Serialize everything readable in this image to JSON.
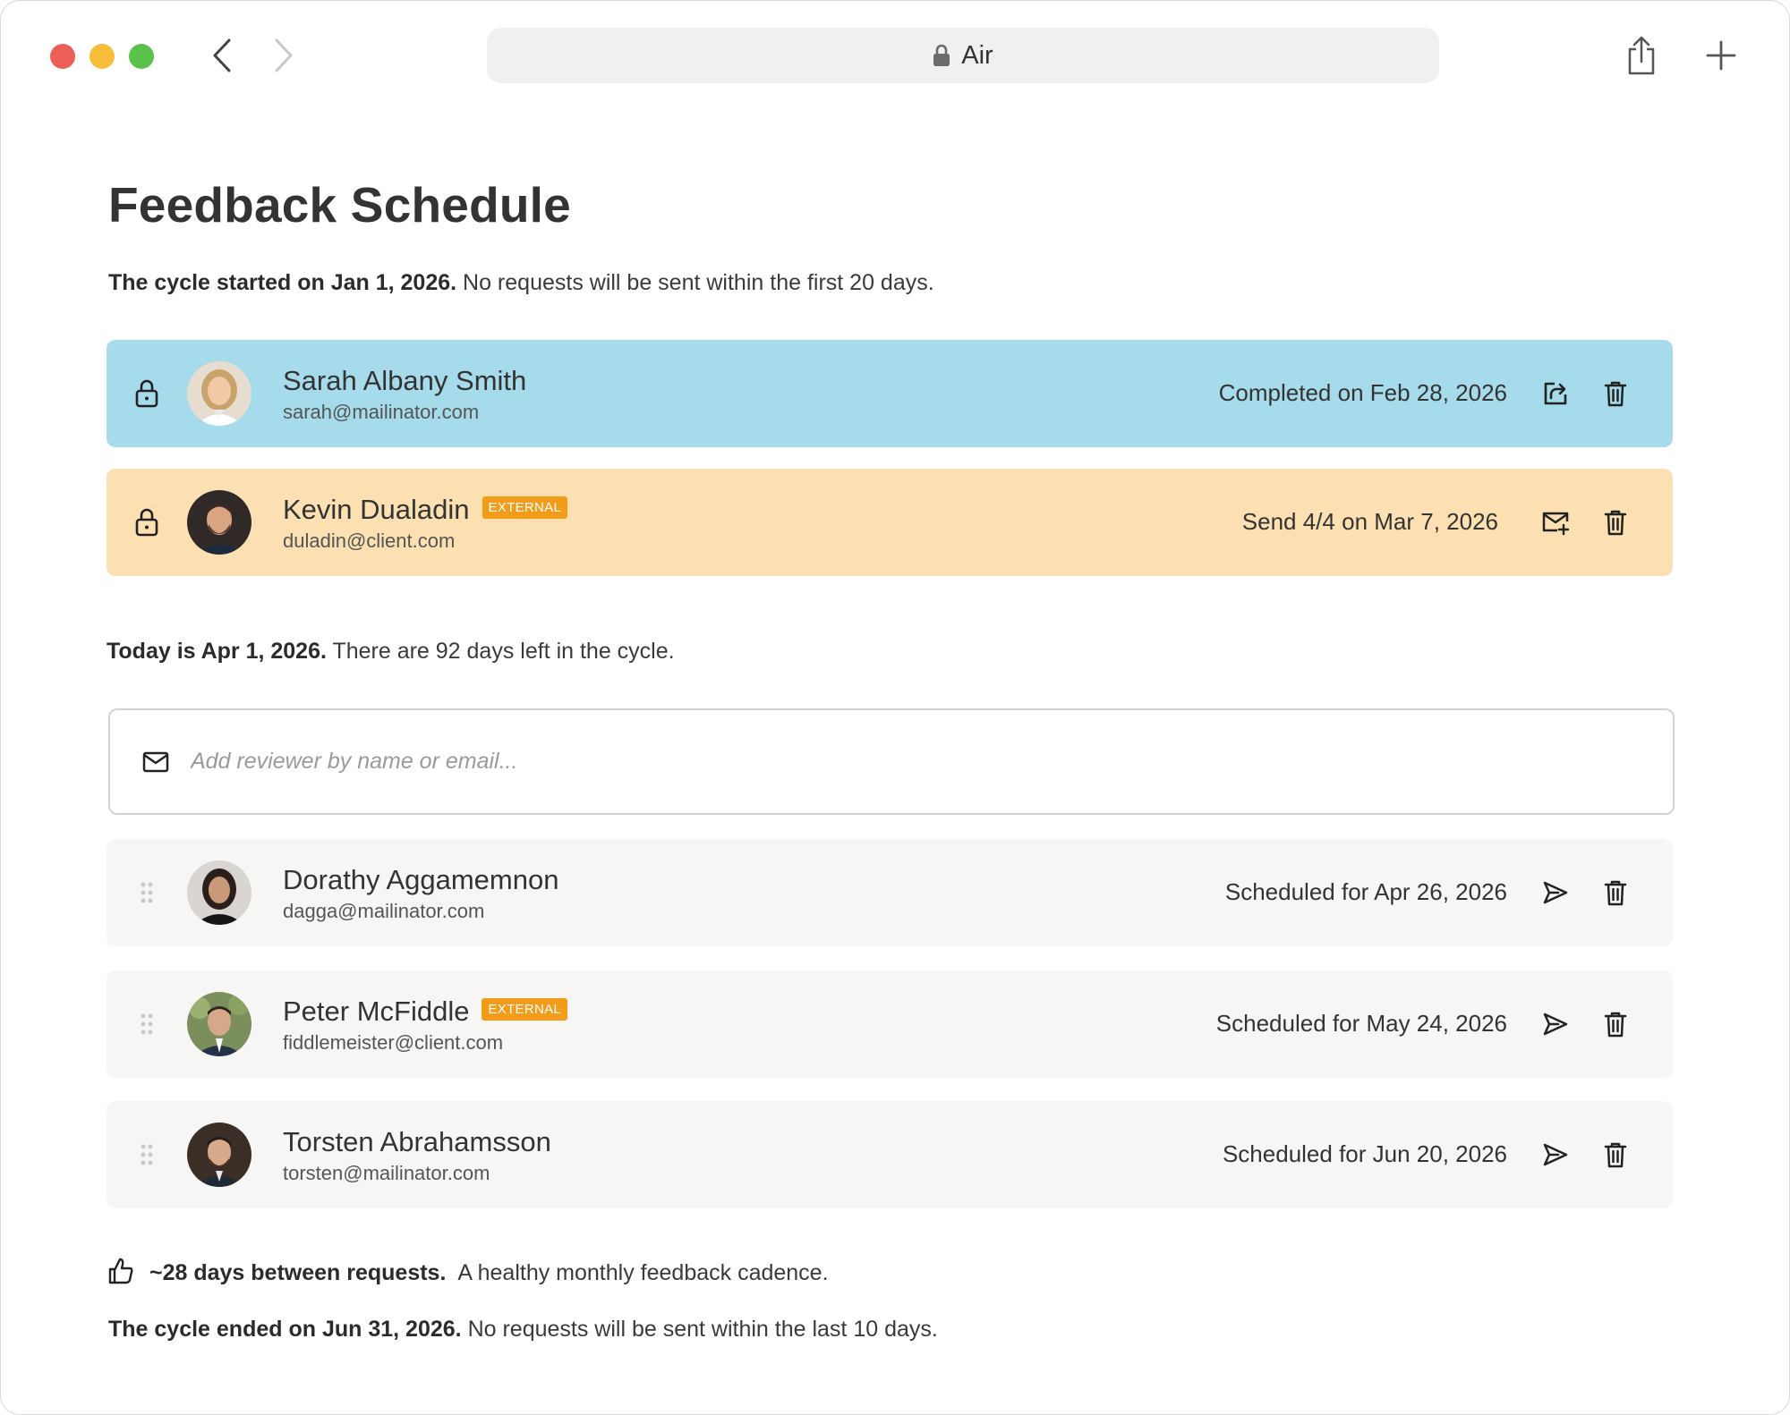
{
  "browser": {
    "url": "Air"
  },
  "page": {
    "title": "Feedback Schedule",
    "cycle_start": {
      "bold": "The cycle started on Jan 1, 2026.",
      "text": "No requests will be sent within the first 20 days."
    },
    "today": {
      "bold": "Today is Apr 1, 2026.",
      "text": "There are 92 days left in the cycle."
    },
    "cadence": {
      "bold": "~28 days between requests.",
      "text": "A healthy monthly feedback cadence."
    },
    "cycle_end": {
      "bold": "The cycle ended on Jun 31, 2026.",
      "text": "No requests will be sent within the last 10 days."
    }
  },
  "add_reviewer": {
    "placeholder": "Add reviewer by name or email..."
  },
  "reviewers_locked": [
    {
      "name": "Sarah Albany Smith",
      "email": "sarah@mailinator.com",
      "badge": "",
      "status": "Completed on Feb 28, 2026",
      "row_color": "#a6dbeb",
      "action_icon": "external-link-icon"
    },
    {
      "name": "Kevin Dualadin",
      "email": "duladin@client.com",
      "badge": "EXTERNAL",
      "status": "Send 4/4 on Mar 7, 2026",
      "row_color": "#fde0b2",
      "action_icon": "mail-plus-icon"
    }
  ],
  "reviewers_scheduled": [
    {
      "name": "Dorathy Aggamemnon",
      "email": "dagga@mailinator.com",
      "badge": "",
      "status": "Scheduled for Apr 26, 2026"
    },
    {
      "name": "Peter McFiddle",
      "email": "fiddlemeister@client.com",
      "badge": "EXTERNAL",
      "status": "Scheduled for May 24, 2026"
    },
    {
      "name": "Torsten Abrahamsson",
      "email": "torsten@mailinator.com",
      "badge": "",
      "status": "Scheduled for Jun 20, 2026"
    }
  ],
  "colors": {
    "badge": "#f39c1a",
    "completed_row": "#a6dbeb",
    "pending_row": "#fde0b2",
    "scheduled_row": "#f7f6f4"
  }
}
